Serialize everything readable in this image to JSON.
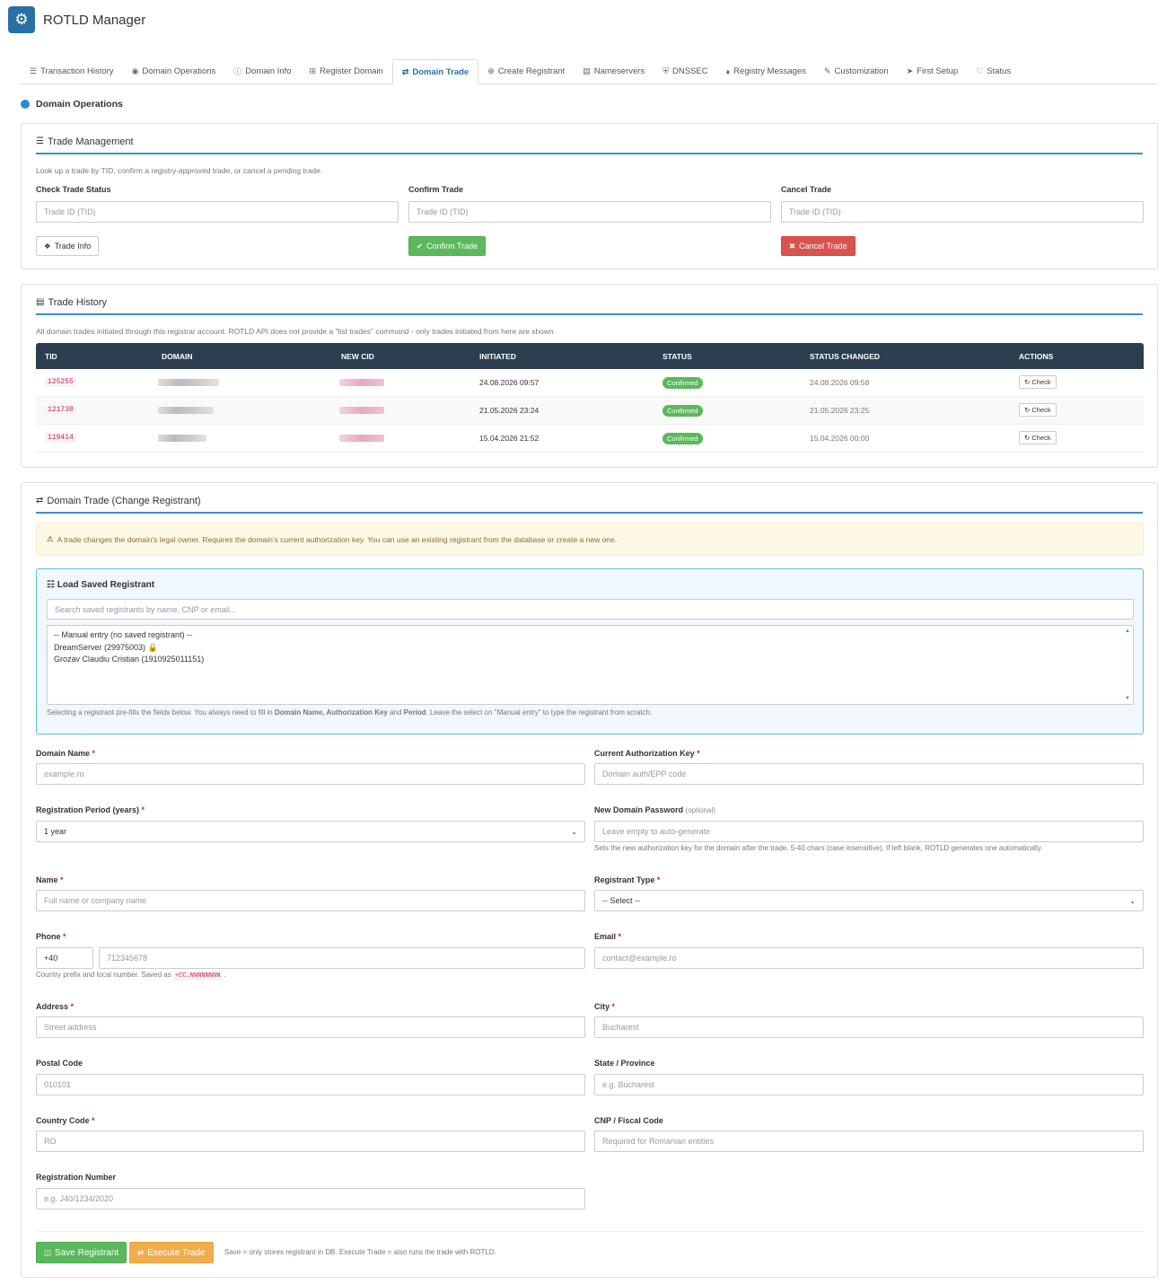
{
  "app": {
    "title": "ROTLD Manager",
    "logo_icon": "gear-icon",
    "brand_color": "#2a6fa8"
  },
  "tabs": [
    {
      "label": "Transaction History",
      "icon": "list-icon"
    },
    {
      "label": "Domain Operations",
      "icon": "globe-icon"
    },
    {
      "label": "Domain Info",
      "icon": "info-icon"
    },
    {
      "label": "Register Domain",
      "icon": "plus-square-icon"
    },
    {
      "label": "Domain Trade",
      "icon": "exchange-icon",
      "active": true
    },
    {
      "label": "Create Registrant",
      "icon": "plus-circle-icon"
    },
    {
      "label": "Nameservers",
      "icon": "server-icon"
    },
    {
      "label": "DNSSEC",
      "icon": "shield-icon"
    },
    {
      "label": "Registry Messages",
      "icon": "bell-icon"
    },
    {
      "label": "Customization",
      "icon": "brush-icon"
    },
    {
      "label": "First Setup",
      "icon": "rocket-icon"
    },
    {
      "label": "Status",
      "icon": "heartbeat-icon"
    }
  ],
  "page_heading": "Domain Operations",
  "trade_mgmt": {
    "title": "Trade Management",
    "description": "Look up a trade by TID, confirm a registry-approved trade, or cancel a pending trade.",
    "check": {
      "label": "Check Trade Status",
      "placeholder": "Trade ID (TID)",
      "button": "Trade Info"
    },
    "confirm": {
      "label": "Confirm Trade",
      "placeholder": "Trade ID (TID)",
      "button": "Confirm Trade"
    },
    "cancel": {
      "label": "Cancel Trade",
      "placeholder": "Trade ID (TID)",
      "button": "Cancel Trade"
    }
  },
  "history": {
    "title": "Trade History",
    "description": "All domain trades initiated through this registrar account. ROTLD API does not provide a \"list trades\" command - only trades initiated from here are shown.",
    "columns": [
      "TID",
      "DOMAIN",
      "NEW CID",
      "INITIATED",
      "STATUS",
      "STATUS CHANGED",
      "ACTIONS"
    ],
    "rows": [
      {
        "tid": "125255",
        "initiated": "24.08.2026 09:57",
        "status": "Confirmed",
        "changed": "24.08.2026 09:58",
        "action": "Check"
      },
      {
        "tid": "121738",
        "initiated": "21.05.2026 23:24",
        "status": "Confirmed",
        "changed": "21.05.2026 23:25",
        "action": "Check"
      },
      {
        "tid": "119414",
        "initiated": "15.04.2026 21:52",
        "status": "Confirmed",
        "changed": "15.04.2026 00:00",
        "action": "Check"
      }
    ]
  },
  "trade_form": {
    "title": "Domain Trade (Change Registrant)",
    "warning": "A trade changes the domain's legal owner. Requires the domain's current authorization key. You can use an existing registrant from the database or create a new one.",
    "saved": {
      "title": "Load Saved Registrant",
      "search_placeholder": "Search saved registrants by name, CNP or email...",
      "options": [
        "-- Manual entry (no saved registrant) --",
        "DreamServer (29975003) 🔒",
        "Grozav Claudiu Cristian (1910925011151)"
      ],
      "help_pre": "Selecting a registrant pre-fills the fields below. You always need to fill in ",
      "help_bold": "Domain Name, Authorization Key",
      "help_mid": " and ",
      "help_bold2": "Period",
      "help_post": ". Leave the select on \"Manual entry\" to type the registrant from scratch."
    },
    "domain_name": {
      "label": "Domain Name",
      "placeholder": "example.ro"
    },
    "auth_key": {
      "label": "Current Authorization Key",
      "placeholder": "Domain auth/EPP code"
    },
    "period": {
      "label": "Registration Period (years)",
      "value": "1 year"
    },
    "new_password": {
      "label": "New Domain Password",
      "optional": "(optional)",
      "placeholder": "Leave empty to auto-generate",
      "help": "Sets the new authorization key for the domain after the trade. 5-40 chars (case insensitive). If left blank, ROTLD generates one automatically."
    },
    "name": {
      "label": "Name",
      "placeholder": "Full name or company name"
    },
    "registrant_type": {
      "label": "Registrant Type",
      "value": "-- Select --"
    },
    "phone": {
      "label": "Phone",
      "prefix": "+40",
      "placeholder": "712345678",
      "help_pre": "Country prefix and local number. Saved as",
      "help_code": "+CC.NNNNNNNN",
      "help_post": "."
    },
    "email": {
      "label": "Email",
      "placeholder": "contact@example.ro"
    },
    "address": {
      "label": "Address",
      "placeholder": "Street address"
    },
    "city": {
      "label": "City",
      "placeholder": "Bucharest"
    },
    "postal": {
      "label": "Postal Code",
      "placeholder": "010101"
    },
    "state": {
      "label": "State / Province",
      "placeholder": "e.g. Bucharest"
    },
    "country": {
      "label": "Country Code",
      "placeholder": "RO"
    },
    "cnp": {
      "label": "CNP / Fiscal Code",
      "placeholder": "Required for Romanian entities"
    },
    "reg_number": {
      "label": "Registration Number",
      "placeholder": "e.g. J40/1234/2020"
    },
    "save_button": "Save Registrant",
    "execute_button": "Execute Trade",
    "footer_note": "Save = only stores registrant in DB. Execute Trade = also runs the trade with ROTLD."
  }
}
